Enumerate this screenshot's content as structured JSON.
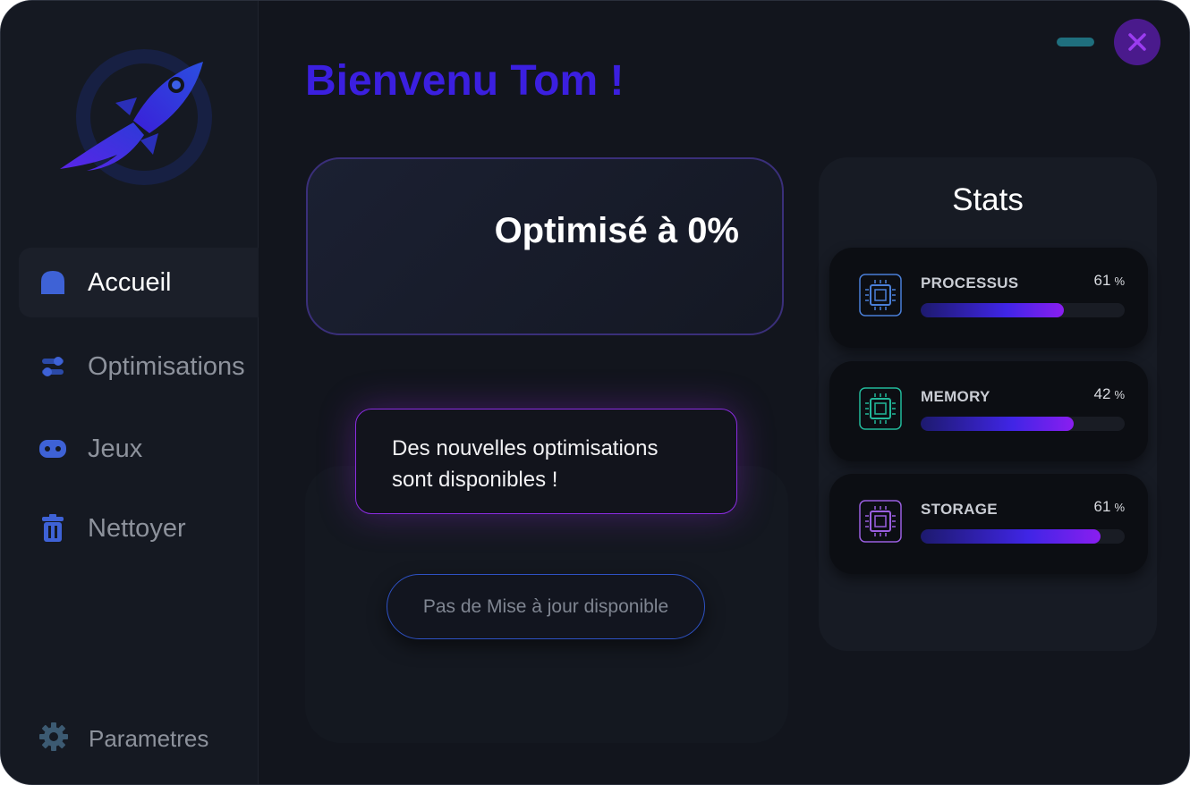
{
  "window": {
    "minimize_icon": "minimize-icon",
    "close_icon": "close-icon"
  },
  "sidebar": {
    "items": [
      {
        "label": "Accueil",
        "icon": "home-icon",
        "active": true
      },
      {
        "label": "Optimisations",
        "icon": "sliders-icon",
        "active": false
      },
      {
        "label": "Jeux",
        "icon": "gamepad-icon",
        "active": false
      },
      {
        "label": "Nettoyer",
        "icon": "trash-icon",
        "active": false
      }
    ],
    "settings": {
      "label": "Parametres",
      "icon": "gear-icon"
    }
  },
  "header": {
    "greeting": "Bienvenu Tom !"
  },
  "main": {
    "optimization_status": "Optimisé à 0%",
    "notification": {
      "line1": "Des nouvelles optimisations",
      "line2": "sont disponibles !"
    },
    "update_button": "Pas de Mise à jour disponible"
  },
  "stats": {
    "title": "Stats",
    "items": [
      {
        "name": "PROCESSUS",
        "value": "61",
        "unit": "%",
        "fraction": 0.7,
        "icon": "cpu-icon",
        "color": "#4a7fd8"
      },
      {
        "name": "MEMORY",
        "value": "42",
        "unit": "%",
        "fraction": 0.75,
        "icon": "memory-chip-icon",
        "color": "#22b89a"
      },
      {
        "name": "STORAGE",
        "value": "61",
        "unit": "%",
        "fraction": 0.88,
        "icon": "storage-chip-icon",
        "color": "#9a5fe0"
      }
    ]
  },
  "colors": {
    "accent": "#3b1fe0",
    "purple": "#8a1ef0",
    "background": "#12151d"
  }
}
